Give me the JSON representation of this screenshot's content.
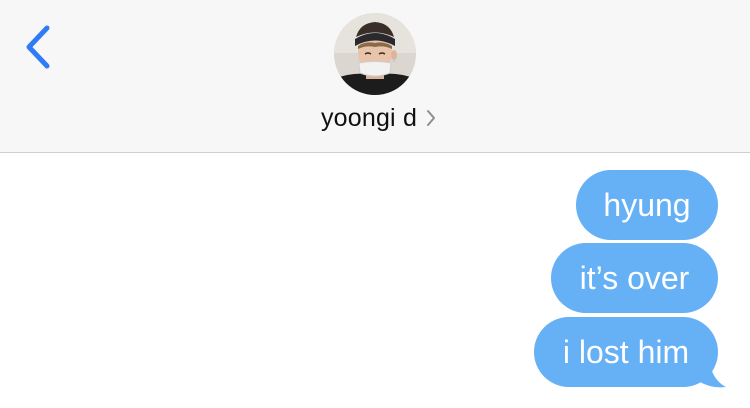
{
  "header": {
    "contact_name": "yoongi d",
    "back_icon": "chevron-left-icon",
    "disclosure_icon": "chevron-right-icon"
  },
  "messages": [
    {
      "text": "hyung",
      "direction": "outgoing"
    },
    {
      "text": "it’s over",
      "direction": "outgoing"
    },
    {
      "text": "i lost him",
      "direction": "outgoing"
    }
  ],
  "colors": {
    "accent": "#2f7cf6",
    "outgoing_bubble": "#66b0f5",
    "header_background": "#f7f7f7"
  }
}
